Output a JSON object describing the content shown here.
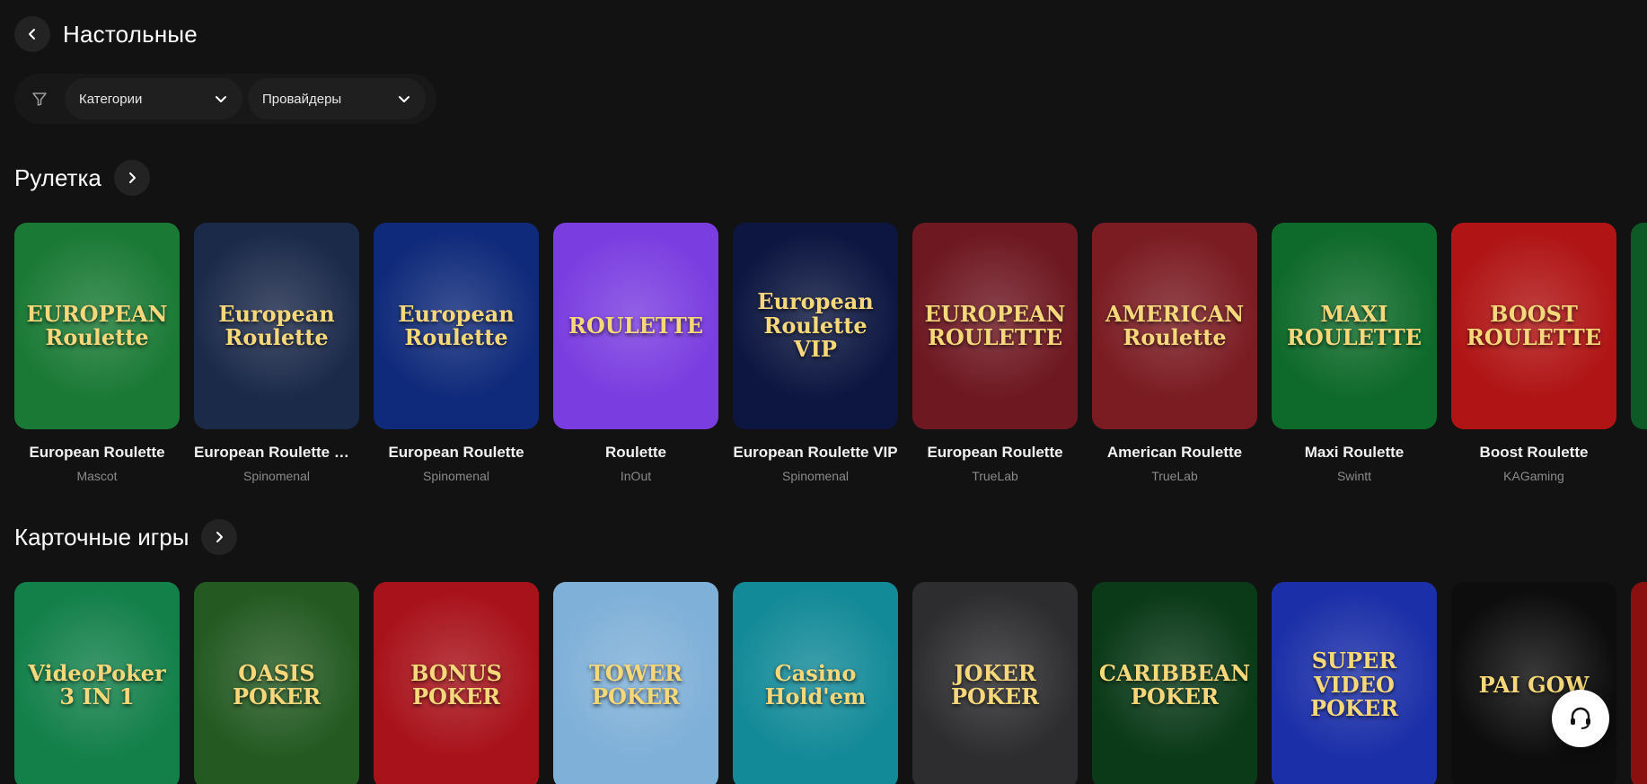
{
  "header": {
    "title": "Настольные"
  },
  "filters": {
    "categories_label": "Категории",
    "providers_label": "Провайдеры"
  },
  "sections": [
    {
      "title": "Рулетка",
      "games": [
        {
          "name": "European Roulette",
          "provider": "Mascot",
          "art": "EUROPEAN Roulette",
          "bg": "#1a7a35"
        },
        {
          "name": "European Roulette Ch...",
          "provider": "Spinomenal",
          "art": "European Roulette",
          "bg": "#1c2a4a"
        },
        {
          "name": "European Roulette",
          "provider": "Spinomenal",
          "art": "European Roulette",
          "bg": "#0f2a7a"
        },
        {
          "name": "Roulette",
          "provider": "InOut",
          "art": "ROULETTE",
          "bg": "#7a3de0"
        },
        {
          "name": "European Roulette VIP",
          "provider": "Spinomenal",
          "art": "European Roulette VIP",
          "bg": "#0c1640"
        },
        {
          "name": "European Roulette",
          "provider": "TrueLab",
          "art": "EUROPEAN ROULETTE",
          "bg": "#6e1822"
        },
        {
          "name": "American Roulette",
          "provider": "TrueLab",
          "art": "AMERICAN Roulette",
          "bg": "#7a1c22"
        },
        {
          "name": "Maxi Roulette",
          "provider": "Swintt",
          "art": "MAXI ROULETTE",
          "bg": "#0e6a2a"
        },
        {
          "name": "Boost Roulette",
          "provider": "KAGaming",
          "art": "BOOST ROULETTE",
          "bg": "#b01414"
        }
      ]
    },
    {
      "title": "Карточные игры",
      "games": [
        {
          "art": "VideoPoker 3 IN 1",
          "bg": "#13804a"
        },
        {
          "art": "OASIS POKER",
          "bg": "#245a22"
        },
        {
          "art": "BONUS POKER",
          "bg": "#a8121a"
        },
        {
          "art": "TOWER POKER",
          "bg": "#7fb0d8"
        },
        {
          "art": "Casino Hold'em",
          "bg": "#138a98"
        },
        {
          "art": "JOKER POKER",
          "bg": "#2d2d2f"
        },
        {
          "art": "CARIBBEAN POKER",
          "bg": "#0a3a18"
        },
        {
          "art": "SUPER VIDEO POKER",
          "bg": "#1b2fa8"
        },
        {
          "art": "PAI GOW",
          "bg": "#0d0d0d"
        }
      ]
    }
  ],
  "colors": {
    "background": "#121212",
    "card_title": "#f2f2f2",
    "provider": "#8a8a8a"
  },
  "icons": [
    "chevron-left-icon",
    "filter-icon",
    "chevron-down-icon",
    "chevron-right-icon",
    "headset-icon"
  ]
}
